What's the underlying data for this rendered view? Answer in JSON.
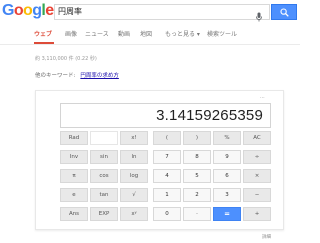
{
  "header": {
    "logo_letters": [
      {
        "char": "G",
        "color": "#4285f4"
      },
      {
        "char": "o",
        "color": "#ea4335"
      },
      {
        "char": "o",
        "color": "#fbbc05"
      },
      {
        "char": "g",
        "color": "#4285f4"
      },
      {
        "char": "l",
        "color": "#34a853"
      },
      {
        "char": "e",
        "color": "#ea4335"
      }
    ],
    "search_value": "円周率",
    "mic_icon": "microphone-icon",
    "search_icon": "search-icon"
  },
  "tabs": [
    {
      "label": "ウェブ",
      "active": true
    },
    {
      "label": "画像",
      "active": false
    },
    {
      "label": "ニュース",
      "active": false
    },
    {
      "label": "動画",
      "active": false
    },
    {
      "label": "地図",
      "active": false
    },
    {
      "label": "もっと見る ▾",
      "active": false
    },
    {
      "label": "検索ツール",
      "active": false
    }
  ],
  "stats": "約 3,110,000 件 (0.22 秒)",
  "related": {
    "label": "他のキーワード:",
    "link": "円周率の求め方"
  },
  "calculator": {
    "display": "3.14159265359",
    "history_icon": "⋯",
    "keys": [
      {
        "label": "Rad",
        "type": "op"
      },
      {
        "label": "",
        "type": "blank"
      },
      {
        "label": "x!",
        "type": "op"
      },
      {
        "label": "(",
        "type": "op"
      },
      {
        "label": ")",
        "type": "op"
      },
      {
        "label": "%",
        "type": "op"
      },
      {
        "label": "AC",
        "type": "op"
      },
      {
        "label": "Inv",
        "type": "op"
      },
      {
        "label": "sin",
        "type": "op"
      },
      {
        "label": "ln",
        "type": "op"
      },
      {
        "label": "7",
        "type": "num"
      },
      {
        "label": "8",
        "type": "num"
      },
      {
        "label": "9",
        "type": "num"
      },
      {
        "label": "÷",
        "type": "op"
      },
      {
        "label": "π",
        "type": "op"
      },
      {
        "label": "cos",
        "type": "op"
      },
      {
        "label": "log",
        "type": "op"
      },
      {
        "label": "4",
        "type": "num"
      },
      {
        "label": "5",
        "type": "num"
      },
      {
        "label": "6",
        "type": "num"
      },
      {
        "label": "×",
        "type": "op"
      },
      {
        "label": "e",
        "type": "op"
      },
      {
        "label": "tan",
        "type": "op"
      },
      {
        "label": "√",
        "type": "op"
      },
      {
        "label": "1",
        "type": "num"
      },
      {
        "label": "2",
        "type": "num"
      },
      {
        "label": "3",
        "type": "num"
      },
      {
        "label": "−",
        "type": "op"
      },
      {
        "label": "Ans",
        "type": "op"
      },
      {
        "label": "EXP",
        "type": "op"
      },
      {
        "label": "xʸ",
        "type": "op"
      },
      {
        "label": "0",
        "type": "num"
      },
      {
        "label": "·",
        "type": "num"
      },
      {
        "label": "=",
        "type": "eq"
      },
      {
        "label": "+",
        "type": "op"
      }
    ]
  },
  "feedback": "詳細"
}
